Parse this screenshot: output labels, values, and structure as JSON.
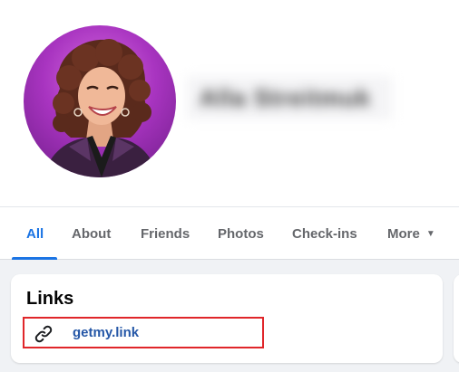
{
  "profile": {
    "name": "Alla Streitmuk",
    "avatar_icon": "profile-photo"
  },
  "tabs": [
    {
      "label": "All",
      "active": true
    },
    {
      "label": "About",
      "active": false
    },
    {
      "label": "Friends",
      "active": false
    },
    {
      "label": "Photos",
      "active": false
    },
    {
      "label": "Check-ins",
      "active": false
    },
    {
      "label": "More",
      "active": false,
      "icon": "caret-down-icon"
    }
  ],
  "links_section": {
    "title": "Links",
    "items": [
      {
        "icon": "link-icon",
        "text": "getmy.link",
        "highlighted": true
      }
    ]
  },
  "colors": {
    "accent": "#1b74e4",
    "link": "#2557a7",
    "highlight_border": "#e0262a",
    "background": "#f0f2f5"
  }
}
